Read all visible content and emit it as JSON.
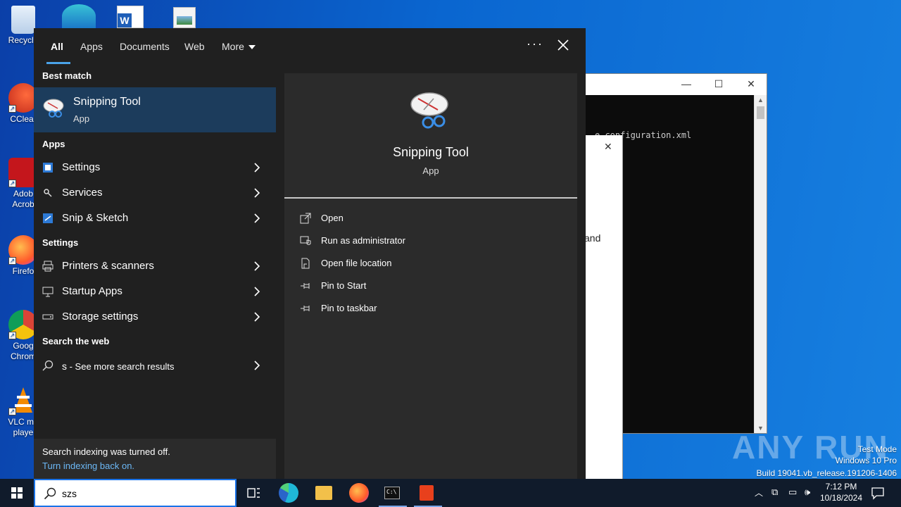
{
  "desktop": {
    "icons": [
      {
        "label": "Recycle",
        "icon": "recycle-bin-icon"
      },
      {
        "label": "CClear",
        "icon": "ccleaner-icon"
      },
      {
        "label": "Adob Acrob",
        "icon": "adobe-acrobat-icon"
      },
      {
        "label": "Firefo",
        "icon": "firefox-icon"
      },
      {
        "label": "Goog Chrom",
        "icon": "chrome-icon"
      },
      {
        "label": "VLC me playe",
        "icon": "vlc-icon"
      }
    ]
  },
  "background_window": {
    "terminal_text": "e configuration.xml",
    "dialog_text": "and"
  },
  "watermark": {
    "logo": "ANY RUN",
    "line1": "Test Mode",
    "line2": "Windows 10 Pro",
    "line3": "Build 19041.vb_release.191206-1406"
  },
  "search_panel": {
    "tabs": [
      "All",
      "Apps",
      "Documents",
      "Web",
      "More"
    ],
    "active_tab": "All",
    "more_options": "···",
    "sections": {
      "best_match": "Best match",
      "apps": "Apps",
      "settings": "Settings",
      "search_web": "Search the web"
    },
    "best_match": {
      "title": "Snipping Tool",
      "subtitle": "App",
      "icon": "snipping-tool-icon"
    },
    "app_results": [
      {
        "label": "Settings",
        "icon": "settings-icon"
      },
      {
        "label": "Services",
        "icon": "services-icon"
      },
      {
        "label": "Snip & Sketch",
        "icon": "snip-sketch-icon"
      }
    ],
    "setting_results": [
      {
        "label": "Printers & scanners",
        "icon": "printer-icon"
      },
      {
        "label": "Startup Apps",
        "icon": "startup-icon"
      },
      {
        "label": "Storage settings",
        "icon": "storage-icon"
      }
    ],
    "web_result": {
      "query": "s",
      "suffix": " - See more search results",
      "icon": "search-icon"
    },
    "status": {
      "message": "Search indexing was turned off.",
      "link": "Turn indexing back on."
    },
    "detail": {
      "title": "Snipping Tool",
      "subtitle": "App",
      "actions": [
        {
          "label": "Open",
          "icon": "open-icon"
        },
        {
          "label": "Run as administrator",
          "icon": "shield-icon"
        },
        {
          "label": "Open file location",
          "icon": "file-location-icon"
        },
        {
          "label": "Pin to Start",
          "icon": "pin-icon"
        },
        {
          "label": "Pin to taskbar",
          "icon": "pin-icon"
        }
      ]
    }
  },
  "taskbar": {
    "search_value": "szs",
    "time": "7:12 PM",
    "date": "10/18/2024",
    "colors": {
      "bg": "#101b2b",
      "accent": "#1a73e8"
    }
  }
}
